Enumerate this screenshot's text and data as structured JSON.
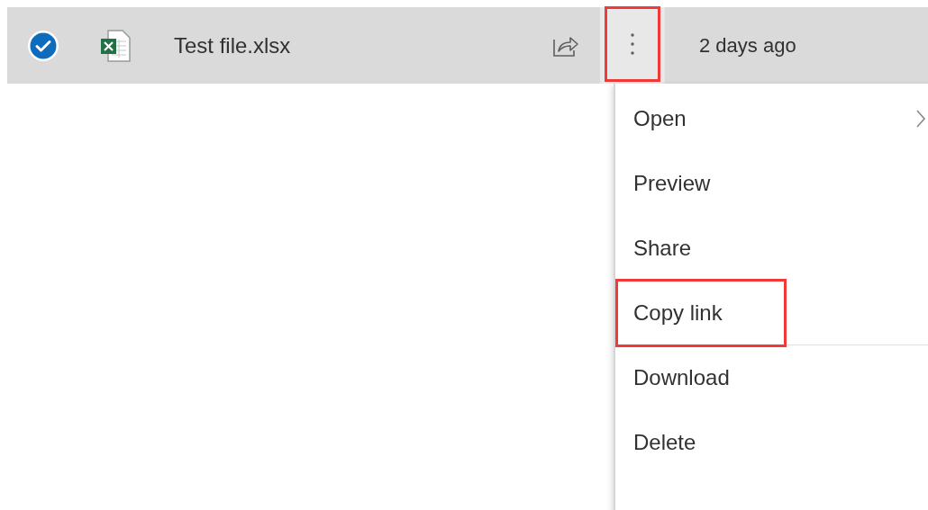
{
  "file_row": {
    "selected": true,
    "name": "Test file.xlsx",
    "modified": "2 days ago",
    "more_button": {
      "highlighted": true
    }
  },
  "context_menu": {
    "items": [
      {
        "label": "Open",
        "submenu": true,
        "highlighted": false,
        "divider_after": false
      },
      {
        "label": "Preview",
        "submenu": false,
        "highlighted": false,
        "divider_after": false
      },
      {
        "label": "Share",
        "submenu": false,
        "highlighted": false,
        "divider_after": false
      },
      {
        "label": "Copy link",
        "submenu": false,
        "highlighted": true,
        "divider_after": true
      },
      {
        "label": "Download",
        "submenu": false,
        "highlighted": false,
        "divider_after": false
      },
      {
        "label": "Delete",
        "submenu": false,
        "highlighted": false,
        "divider_after": false
      }
    ]
  }
}
